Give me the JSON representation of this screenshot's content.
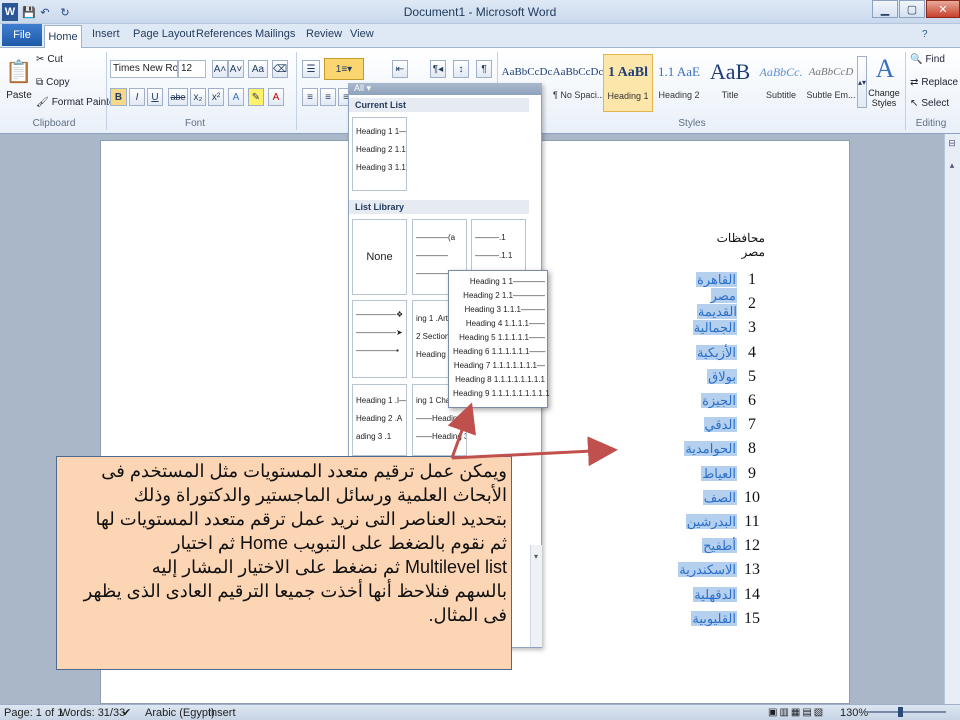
{
  "window": {
    "title": "Document1 - Microsoft Word"
  },
  "quick_access": {
    "word_icon": "W",
    "save": "💾",
    "undo": "↶",
    "redo": "↻"
  },
  "tabs": [
    "Home",
    "Insert",
    "Page Layout",
    "References",
    "Mailings",
    "Review",
    "View"
  ],
  "file_tab": "File",
  "clipboard": {
    "paste": "Paste",
    "cut": "Cut",
    "copy": "Copy",
    "format_painter": "Format Painter",
    "label": "Clipboard"
  },
  "font": {
    "name": "Times New Rom",
    "size": "12",
    "grow": "A˄",
    "shrink": "A˅",
    "case": "Aa",
    "bold": "B",
    "italic": "I",
    "underline": "U",
    "strike": "abe",
    "sub": "x₂",
    "sup": "x²",
    "label": "Font"
  },
  "paragraph": {
    "label": ""
  },
  "styles": {
    "label": "Styles",
    "items": [
      {
        "sample": "AaBbCcDc",
        "name": ""
      },
      {
        "sample": "AaBbCcDc",
        "name": "¶ No Spaci..."
      },
      {
        "sample": "1 AaBl",
        "name": "Heading 1"
      },
      {
        "sample": "1.1 AaE",
        "name": "Heading 2"
      },
      {
        "sample": "AaB",
        "name": "Title"
      },
      {
        "sample": "AaBbCc.",
        "name": "Subtitle"
      },
      {
        "sample": "AaBbCcD",
        "name": "Subtle Em..."
      }
    ],
    "change_styles": "Change Styles"
  },
  "editing": {
    "find": "Find",
    "replace": "Replace",
    "select": "Select",
    "label": "Editing"
  },
  "multilevel_menu": {
    "filter": "All",
    "current_list_header": "Current List",
    "current_list": [
      "Heading 1 1—",
      "Heading 2 1.1",
      "Heading 3 1.1.1"
    ],
    "library_header": "List Library",
    "none_label": "None",
    "lib_item2": [
      "(a",
      ""
    ],
    "lib_item3": [
      ".1",
      ".1.1"
    ],
    "lib_item5": [
      "ing 1 .Arti",
      "2 Section",
      "Heading 3"
    ],
    "lib_item7": [
      "Heading 1 .I—",
      "Heading 2 .A",
      "ading 3 .1"
    ],
    "lib_item8": [
      "ing 1 Chap",
      "Heading 2",
      "Heading 3"
    ],
    "preview": [
      "Heading 1 1————",
      "Heading 2 1.1————",
      "Heading 3 1.1.1———",
      "Heading 4 1.1.1.1——",
      "Heading 5 1.1.1.1.1——",
      "Heading 6 1.1.1.1.1.1——",
      "Heading 7 1.1.1.1.1.1.1—",
      "Heading 8 1.1.1.1.1.1.1.1",
      "Heading 9 1.1.1.1.1.1.1.1.1"
    ]
  },
  "document": {
    "title": "محافظات مصر",
    "items": [
      {
        "num": "1",
        "name": "القاهرة"
      },
      {
        "num": "2",
        "name": "مصر القديمة"
      },
      {
        "num": "3",
        "name": "الجمالية"
      },
      {
        "num": "4",
        "name": "الأزبكية"
      },
      {
        "num": "5",
        "name": "بولاق"
      },
      {
        "num": "6",
        "name": "الجيزة"
      },
      {
        "num": "7",
        "name": "الدقي"
      },
      {
        "num": "8",
        "name": "الحوامدية"
      },
      {
        "num": "9",
        "name": "العياط"
      },
      {
        "num": "10",
        "name": "الصف"
      },
      {
        "num": "11",
        "name": "البدرشين"
      },
      {
        "num": "12",
        "name": "أطفيح"
      },
      {
        "num": "13",
        "name": "الاسكندرية"
      },
      {
        "num": "14",
        "name": "الدقهلية"
      },
      {
        "num": "15",
        "name": "القليوبية"
      }
    ]
  },
  "callout": {
    "lines": [
      "ويمكن عمل ترقيم متعدد المستويات مثل المستخدم فى",
      "الأبحاث العلمية ورسائل الماجستير والدكتوراة وذلك",
      "بتحديد العناصر التى نريد عمل ترقم متعدد المستويات لها",
      "ثم نقوم بالضغط على التبويب Home ثم اختيار",
      "Multilevel list ثم نضغط على الاختيار المشار إليه",
      "بالسهم فنلاحظ أنها أخذت جميعا الترقيم العادى الذى يظهر",
      "فى المثال."
    ]
  },
  "status": {
    "page": "Page: 1 of 1",
    "words": "Words: 31/33",
    "language": "Arabic (Egypt)",
    "mode": "Insert",
    "zoom": "130%"
  }
}
